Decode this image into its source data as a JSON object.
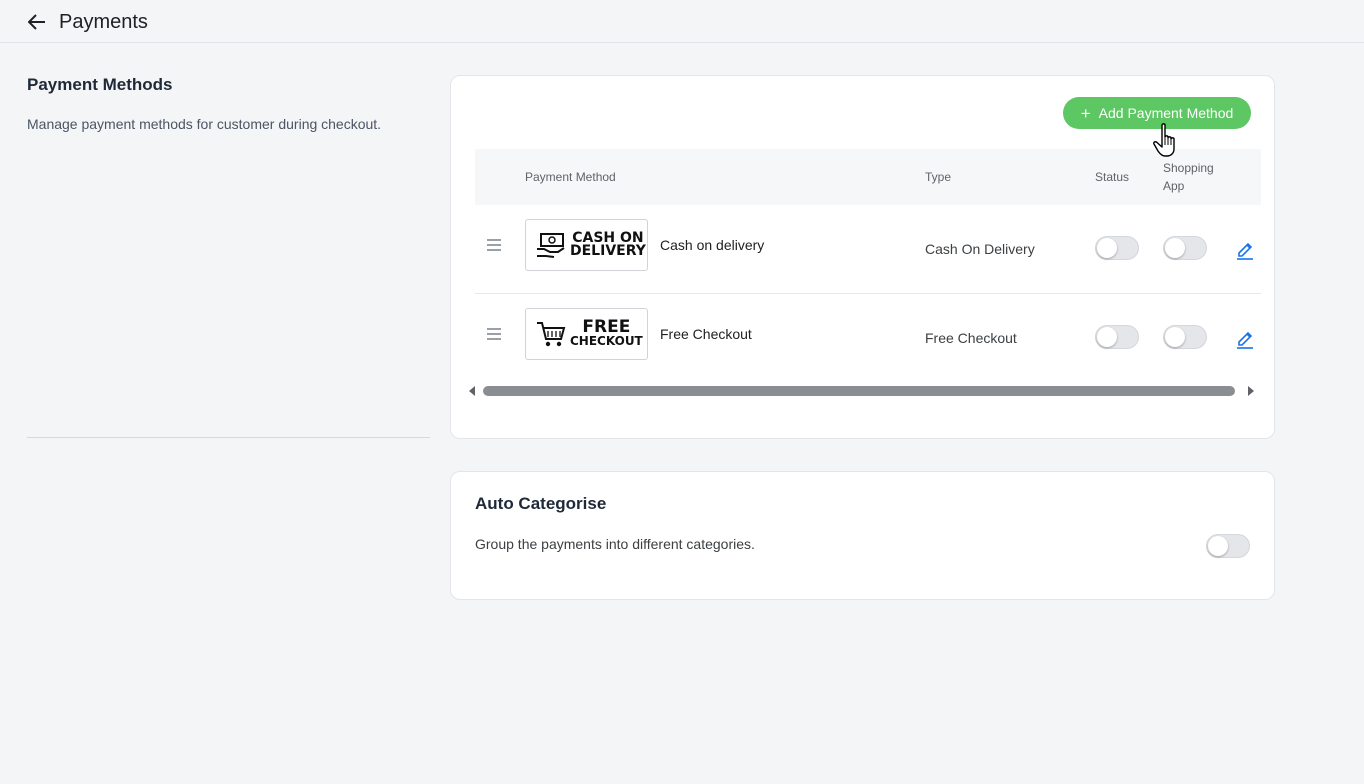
{
  "header": {
    "title": "Payments",
    "back_icon": "arrow-left-icon"
  },
  "sidebar": {
    "title": "Payment Methods",
    "description": "Manage payment methods for customer during checkout."
  },
  "methods_card": {
    "add_button_label": "Add Payment Method",
    "columns": {
      "method": "Payment Method",
      "type": "Type",
      "status": "Status",
      "app": "Shopping App"
    },
    "rows": [
      {
        "logo_line1": "CASH ON",
        "logo_line2": "DELIVERY",
        "name": "Cash on delivery",
        "type": "Cash On Delivery",
        "status_on": false,
        "app_on": false
      },
      {
        "logo_line1": "FREE",
        "logo_line2": "CHECKOUT",
        "name": "Free Checkout",
        "type": "Free Checkout",
        "status_on": false,
        "app_on": false
      }
    ]
  },
  "auto_card": {
    "title": "Auto Categorise",
    "description": "Group the payments into different categories.",
    "enabled": false
  },
  "colors": {
    "accent": "#5cc763",
    "edit_icon": "#1a73e8",
    "background": "#f4f5f7"
  }
}
